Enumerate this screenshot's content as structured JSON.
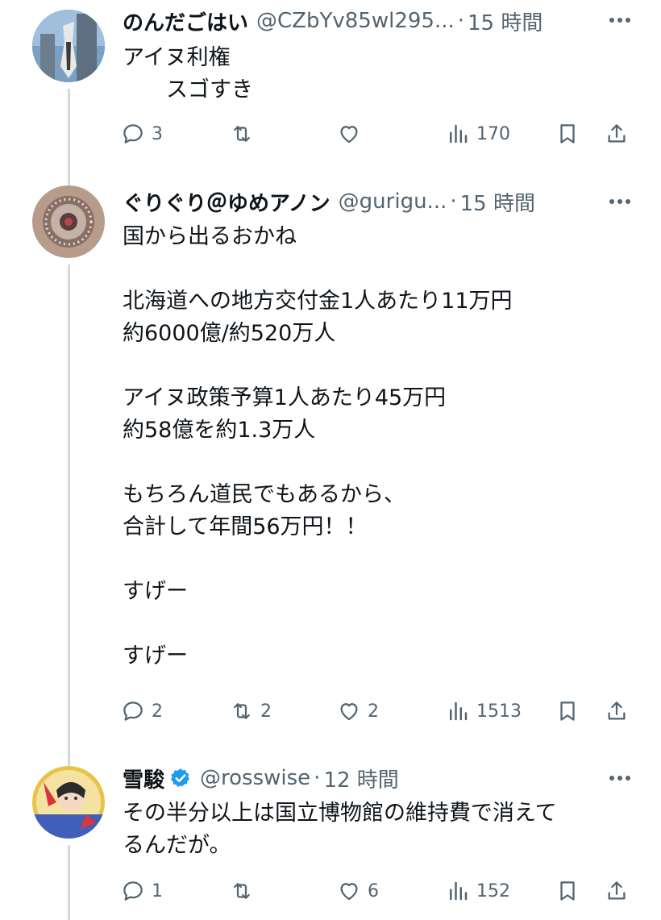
{
  "colors": {
    "text": "#0f1419",
    "muted": "#536471",
    "line": "#cfd9de",
    "verified": "#1d9bf0"
  },
  "tweets": [
    {
      "name": "のんだごはい",
      "handle": "@CZbYv85wl295...",
      "dot": "·",
      "time": "15 時間",
      "lines": [
        "アイヌ利権",
        "　　スゴすき"
      ],
      "replies": "3",
      "retweets": "",
      "likes": "",
      "views": "170"
    },
    {
      "name": "ぐりぐり＠ゆめアノン",
      "handle": "@gurigu...",
      "dot": "·",
      "time": "15 時間",
      "paragraphs": [
        "国から出るおかね",
        "北海道への地方交付金1人あたり11万円\n約6000億/約520万人",
        "アイヌ政策予算1人あたり45万円\n約58億を約1.3万人",
        "もちろん道民でもあるから、\n合計して年間56万円！！",
        "すげー",
        "すげー"
      ],
      "replies": "2",
      "retweets": "2",
      "likes": "2",
      "views": "1513"
    },
    {
      "name": "雪駿",
      "handle": "@rosswise",
      "dot": "·",
      "time": "12 時間",
      "lines": [
        "その半分以上は国立博物館の維持費で消えて",
        "るんだが。"
      ],
      "replies": "1",
      "retweets": "",
      "likes": "6",
      "views": "152"
    }
  ]
}
